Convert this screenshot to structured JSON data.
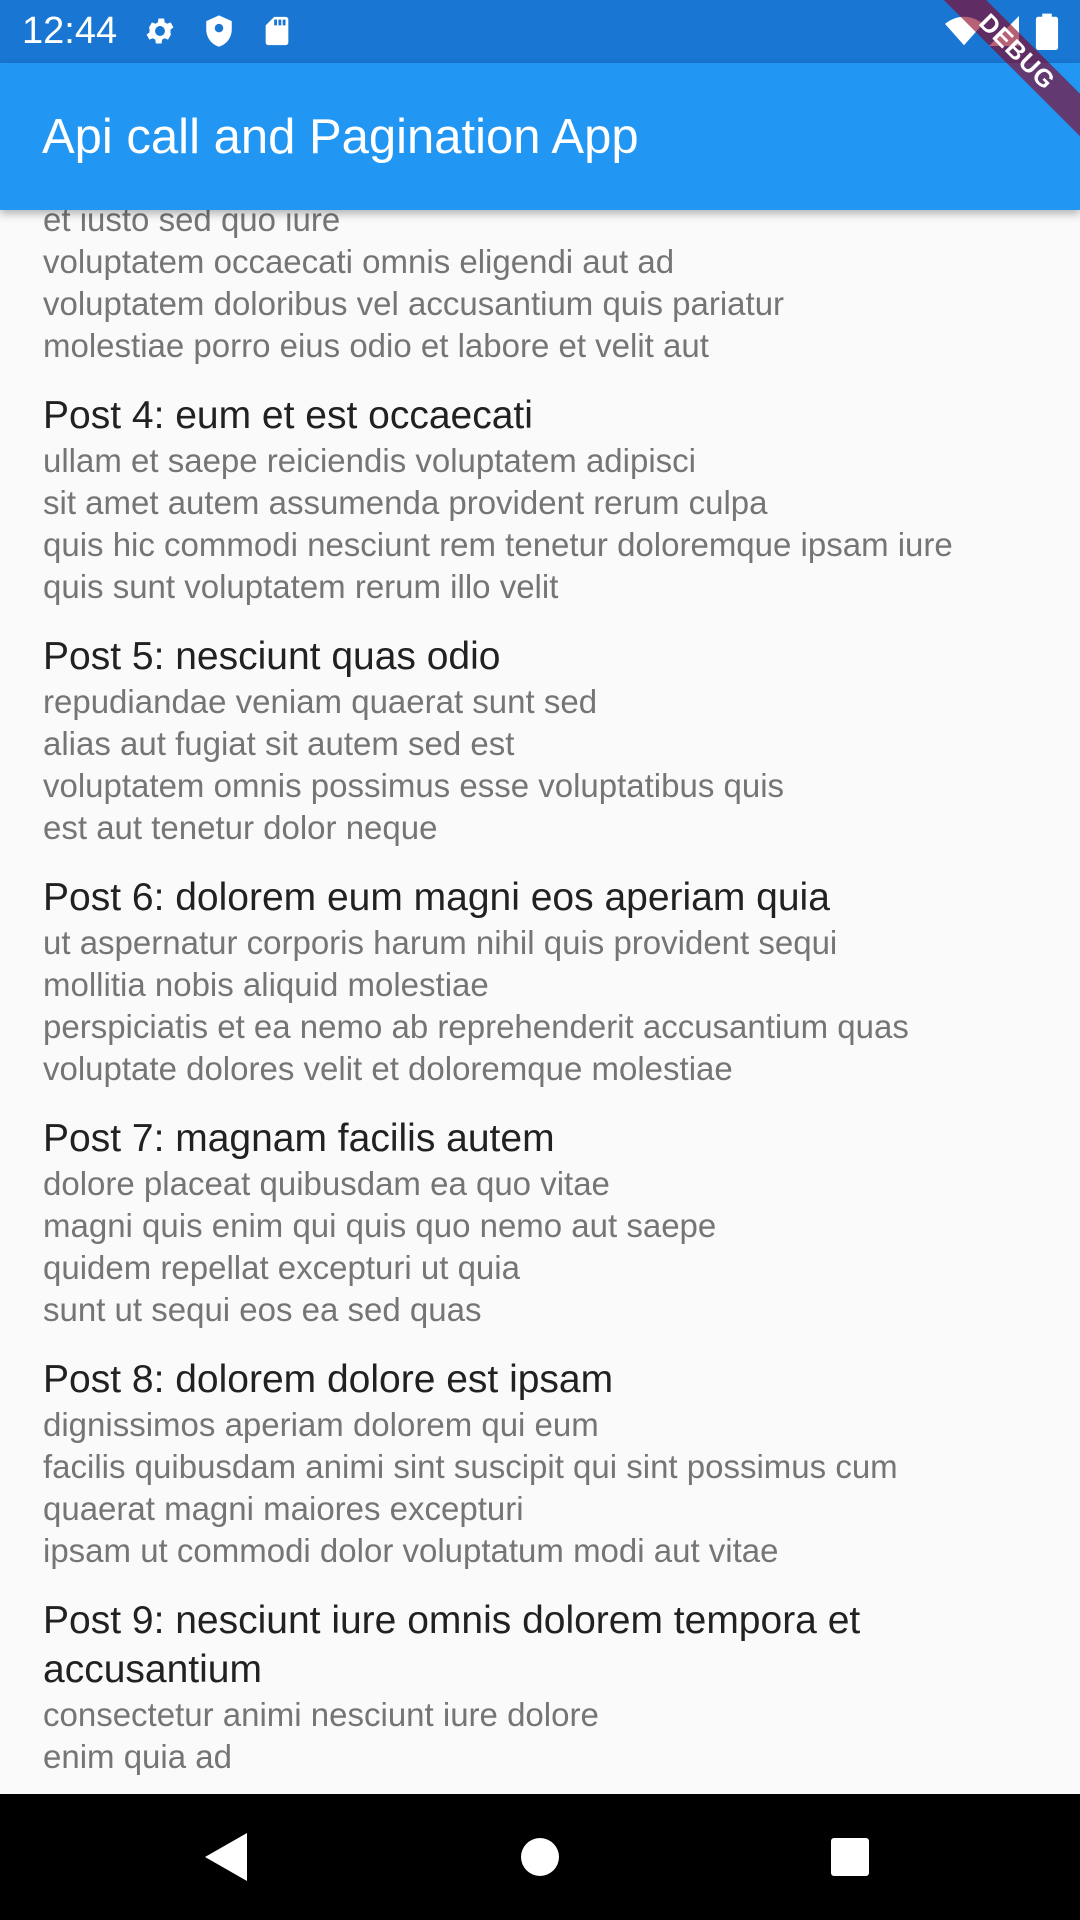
{
  "status_bar": {
    "time": "12:44",
    "icons": [
      "gear-icon",
      "shield-icon",
      "sd-card-icon"
    ],
    "right_icons": [
      "wifi-icon",
      "signal-icon",
      "battery-icon"
    ]
  },
  "debug_banner": "DEBUG",
  "app_bar": {
    "title": "Api call and Pagination App"
  },
  "partial_top_post": {
    "body": "et iusto sed quo iure\nvoluptatem occaecati omnis eligendi aut ad\nvoluptatem doloribus vel accusantium quis pariatur\nmolestiae porro eius odio et labore et velit aut"
  },
  "posts": [
    {
      "title": "Post 4: eum et est occaecati",
      "body": "ullam et saepe reiciendis voluptatem adipisci\nsit amet autem assumenda provident rerum culpa\nquis hic commodi nesciunt rem tenetur doloremque ipsam iure\nquis sunt voluptatem rerum illo velit"
    },
    {
      "title": "Post 5: nesciunt quas odio",
      "body": "repudiandae veniam quaerat sunt sed\nalias aut fugiat sit autem sed est\nvoluptatem omnis possimus esse voluptatibus quis\nest aut tenetur dolor neque"
    },
    {
      "title": "Post 6: dolorem eum magni eos aperiam quia",
      "body": "ut aspernatur corporis harum nihil quis provident sequi\nmollitia nobis aliquid molestiae\nperspiciatis et ea nemo ab reprehenderit accusantium quas\nvoluptate dolores velit et doloremque molestiae"
    },
    {
      "title": "Post 7: magnam facilis autem",
      "body": "dolore placeat quibusdam ea quo vitae\nmagni quis enim qui quis quo nemo aut saepe\nquidem repellat excepturi ut quia\nsunt ut sequi eos ea sed quas"
    },
    {
      "title": "Post 8: dolorem dolore est ipsam",
      "body": "dignissimos aperiam dolorem qui eum\nfacilis quibusdam animi sint suscipit qui sint possimus cum\nquaerat magni maiores excepturi\nipsam ut commodi dolor voluptatum modi aut vitae"
    },
    {
      "title": "Post 9: nesciunt iure omnis dolorem tempora et accusantium",
      "body": "consectetur animi nesciunt iure dolore\nenim quia ad"
    }
  ],
  "nav_bar": {
    "back": "back-icon",
    "home": "home-icon",
    "recents": "recents-icon"
  }
}
